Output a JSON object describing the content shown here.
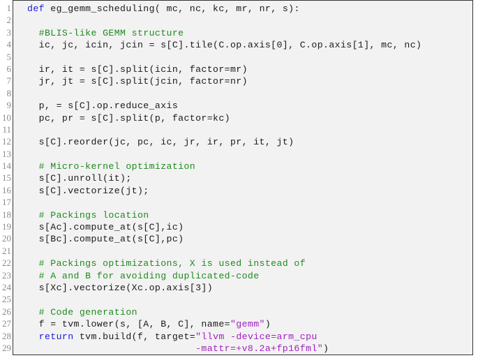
{
  "colors": {
    "keyword": "#1a1adf",
    "comment": "#1f8a1f",
    "string": "#a020c0",
    "text": "#1a1a1a",
    "background": "#f2f2f2",
    "line_number": "#8a8a8a"
  },
  "lines": [
    {
      "n": "1",
      "segs": [
        {
          "t": "kw",
          "v": "def"
        },
        {
          "t": "tx",
          "v": " eg_gemm_scheduling( mc, nc, kc, mr, nr, s):"
        }
      ]
    },
    {
      "n": "2",
      "segs": []
    },
    {
      "n": "3",
      "segs": [
        {
          "t": "cm",
          "v": "  #BLIS-like GEMM structure"
        }
      ]
    },
    {
      "n": "4",
      "segs": [
        {
          "t": "tx",
          "v": "  ic, jc, icin, jcin = s[C].tile(C.op.axis[0], C.op.axis[1], mc, nc)"
        }
      ]
    },
    {
      "n": "5",
      "segs": []
    },
    {
      "n": "6",
      "segs": [
        {
          "t": "tx",
          "v": "  ir, it = s[C].split(icin, factor=mr)"
        }
      ]
    },
    {
      "n": "7",
      "segs": [
        {
          "t": "tx",
          "v": "  jr, jt = s[C].split(jcin, factor=nr)"
        }
      ]
    },
    {
      "n": "8",
      "segs": []
    },
    {
      "n": "9",
      "segs": [
        {
          "t": "tx",
          "v": "  p, = s[C].op.reduce_axis"
        }
      ]
    },
    {
      "n": "10",
      "segs": [
        {
          "t": "tx",
          "v": "  pc, pr = s[C].split(p, factor=kc)"
        }
      ]
    },
    {
      "n": "11",
      "segs": []
    },
    {
      "n": "12",
      "segs": [
        {
          "t": "tx",
          "v": "  s[C].reorder(jc, pc, ic, jr, ir, pr, it, jt)"
        }
      ]
    },
    {
      "n": "13",
      "segs": []
    },
    {
      "n": "14",
      "segs": [
        {
          "t": "cm",
          "v": "  # Micro-kernel optimization"
        }
      ]
    },
    {
      "n": "15",
      "segs": [
        {
          "t": "tx",
          "v": "  s[C].unroll(it);"
        }
      ]
    },
    {
      "n": "16",
      "segs": [
        {
          "t": "tx",
          "v": "  s[C].vectorize(jt);"
        }
      ]
    },
    {
      "n": "17",
      "segs": []
    },
    {
      "n": "18",
      "segs": [
        {
          "t": "cm",
          "v": "  # Packings location"
        }
      ]
    },
    {
      "n": "19",
      "segs": [
        {
          "t": "tx",
          "v": "  s[Ac].compute_at(s[C],ic)"
        }
      ]
    },
    {
      "n": "20",
      "segs": [
        {
          "t": "tx",
          "v": "  s[Bc].compute_at(s[C],pc)"
        }
      ]
    },
    {
      "n": "21",
      "segs": []
    },
    {
      "n": "22",
      "segs": [
        {
          "t": "cm",
          "v": "  # Packings optimizations, X is used instead of"
        }
      ]
    },
    {
      "n": "23",
      "segs": [
        {
          "t": "cm",
          "v": "  # A and B for avoiding duplicated-code"
        }
      ]
    },
    {
      "n": "24",
      "segs": [
        {
          "t": "tx",
          "v": "  s[Xc].vectorize(Xc.op.axis[3])"
        }
      ]
    },
    {
      "n": "25",
      "segs": []
    },
    {
      "n": "26",
      "segs": [
        {
          "t": "cm",
          "v": "  # Code generation"
        }
      ]
    },
    {
      "n": "27",
      "segs": [
        {
          "t": "tx",
          "v": "  f = tvm.lower(s, [A, B, C], name="
        },
        {
          "t": "st",
          "v": "\"gemm\""
        },
        {
          "t": "tx",
          "v": ")"
        }
      ]
    },
    {
      "n": "28",
      "segs": [
        {
          "t": "tx",
          "v": "  "
        },
        {
          "t": "kw",
          "v": "return"
        },
        {
          "t": "tx",
          "v": " tvm.build(f, target="
        },
        {
          "t": "st",
          "v": "\"llvm -device=arm_cpu"
        }
      ]
    },
    {
      "n": "29",
      "segs": [
        {
          "t": "st",
          "v": "                             -mattr=+v8.2a+fp16fml\""
        },
        {
          "t": "tx",
          "v": ")"
        }
      ]
    }
  ]
}
